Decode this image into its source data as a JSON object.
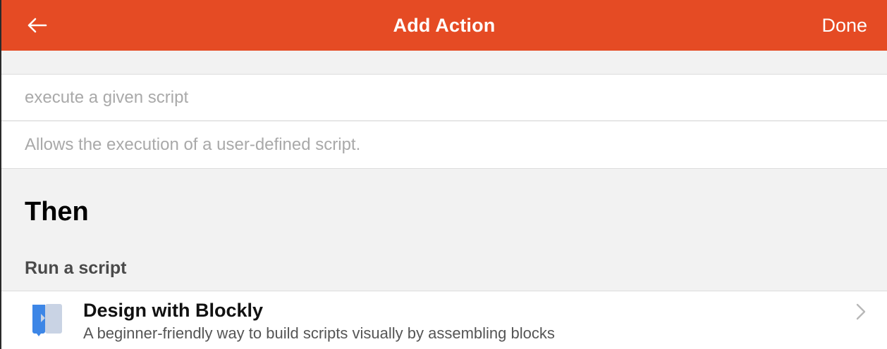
{
  "header": {
    "title": "Add Action",
    "back_icon": "arrow-left-icon",
    "done_label": "Done",
    "color": "#e54b24"
  },
  "trigger": {
    "name_placeholder": "execute a given script",
    "description_placeholder": "Allows the execution of a user-defined script."
  },
  "then_section": {
    "heading": "Then",
    "group_label": "Run a script",
    "items": [
      {
        "title": "Design with Blockly",
        "subtitle": "A beginner-friendly way to build scripts visually by assembling blocks",
        "icon": "blockly-icon",
        "chevron_icon": "chevron-right-icon"
      }
    ]
  }
}
